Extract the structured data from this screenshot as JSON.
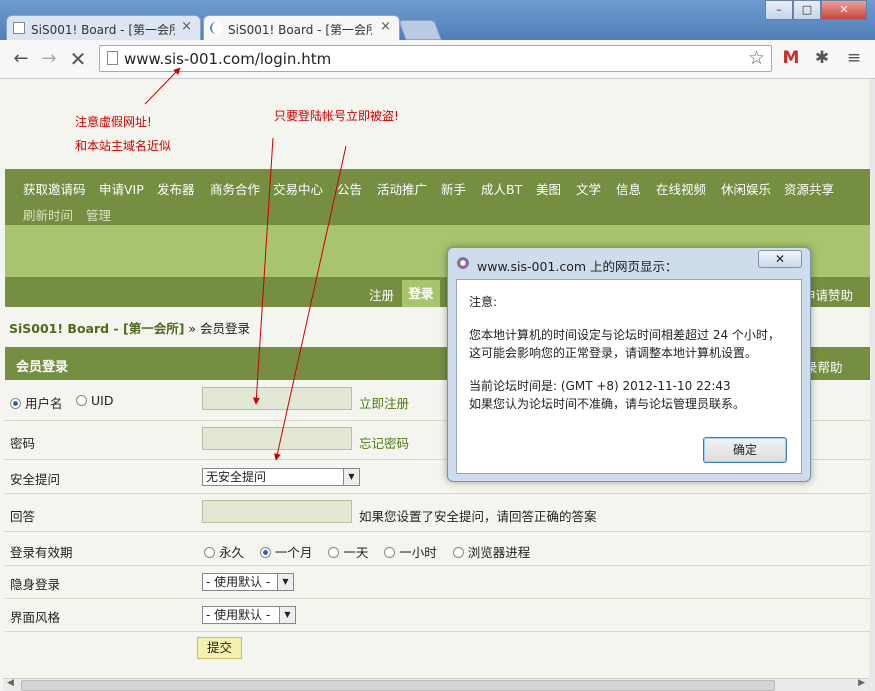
{
  "browser": {
    "tabs": [
      {
        "title": "SiS001! Board - [第一会所]",
        "active": false
      },
      {
        "title": "SiS001! Board - [第一会所]",
        "active": true
      }
    ],
    "window_buttons": [
      "–",
      "□",
      "✕"
    ],
    "url": "www.sis-001.com/login.htm",
    "icons": [
      "back-icon",
      "forward-icon",
      "stop-icon",
      "star-icon",
      "gmail-icon",
      "extension-icon",
      "menu-icon"
    ]
  },
  "annotations": {
    "fake_url_line1": "注意虚假网址!",
    "fake_url_line2": "和本站主域名近似",
    "steal_warning": "只要登陆帐号立即被盗!"
  },
  "nav": {
    "items": [
      "获取邀请码",
      "申请VIP",
      "发布器",
      "商务合作",
      "交易中心",
      "公告",
      "活动推广",
      "新手",
      "成人BT",
      "美图",
      "文学",
      "信息",
      "在线视频",
      "休闲娱乐",
      "资源共享"
    ],
    "items_row2": [
      "刷新时间",
      "管理"
    ],
    "sub": {
      "register": "注册",
      "login": "登录",
      "apply_help": "申请赞助"
    }
  },
  "breadcrumb": {
    "site": "SiS001! Board - [第一会所]",
    "sep": "»",
    "page": "会员登录"
  },
  "form": {
    "header": "会员登录",
    "header_right": "录帮助",
    "username_label": "用户名",
    "uid_label": "UID",
    "register_link": "立即注册",
    "password_label": "密码",
    "forgot_link": "忘记密码",
    "question_label": "安全提问",
    "question_value": "无安全提问",
    "answer_label": "回答",
    "answer_hint": "如果您设置了安全提问，请回答正确的答案",
    "expiry_label": "登录有效期",
    "expiry_options": [
      "永久",
      "一个月",
      "一天",
      "一小时",
      "浏览器进程"
    ],
    "expiry_selected": "一个月",
    "invisible_label": "隐身登录",
    "invisible_value": "- 使用默认 -",
    "style_label": "界面风格",
    "style_value": "- 使用默认 -",
    "submit": "提交"
  },
  "dialog": {
    "title": "www.sis-001.com 上的网页显示：",
    "close": "✕",
    "line1": "注意:",
    "line2": "您本地计算机的时间设定与论坛时间相差超过 24 个小时，",
    "line3": "这可能会影响您的正常登录，请调整本地计算机设置。",
    "line4": "当前论坛时间是: (GMT +8) 2012-11-10 22:43",
    "line5": "如果您认为论坛时间不准确，请与论坛管理员联系。",
    "ok": "确定"
  },
  "colors": {
    "nav_green": "#758e42",
    "band_green": "#a9c46e",
    "annotation_red": "#cc0000"
  }
}
